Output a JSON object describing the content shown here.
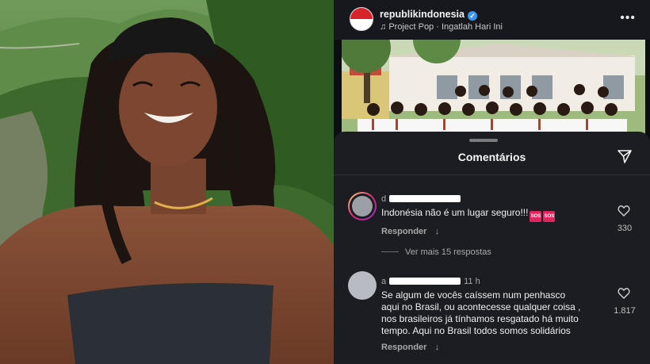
{
  "header": {
    "username": "republikindonesia",
    "music": "Project Pop · Ingatlah Hari Ini",
    "more_icon": "more-horizontal-icon"
  },
  "sheet": {
    "title": "Comentários"
  },
  "comments": [
    {
      "username_visible": "d",
      "text": "Indonésia não é um lugar seguro!!!",
      "emoji": [
        "SOS",
        "SOS"
      ],
      "reply_label": "Responder",
      "likes": "330"
    },
    {
      "username_visible": "a",
      "time": "11 h",
      "text_lines": [
        "Se algum de vocês caíssem num  penhasco",
        "aqui no Brasil,  ou acontecesse qualquer coisa ,",
        "nos brasileiros já tínhamos resgatado há muito",
        "tempo.  Aqui no Brasil todos somos solidários"
      ],
      "reply_label": "Responder",
      "likes": "1.817"
    }
  ],
  "view_replies": "Ver mais 15 respostas",
  "colors": {
    "background": "#0b0f14",
    "sheet": "#1c1d22",
    "verified": "#3897f0",
    "flag_red": "#d8232a"
  }
}
